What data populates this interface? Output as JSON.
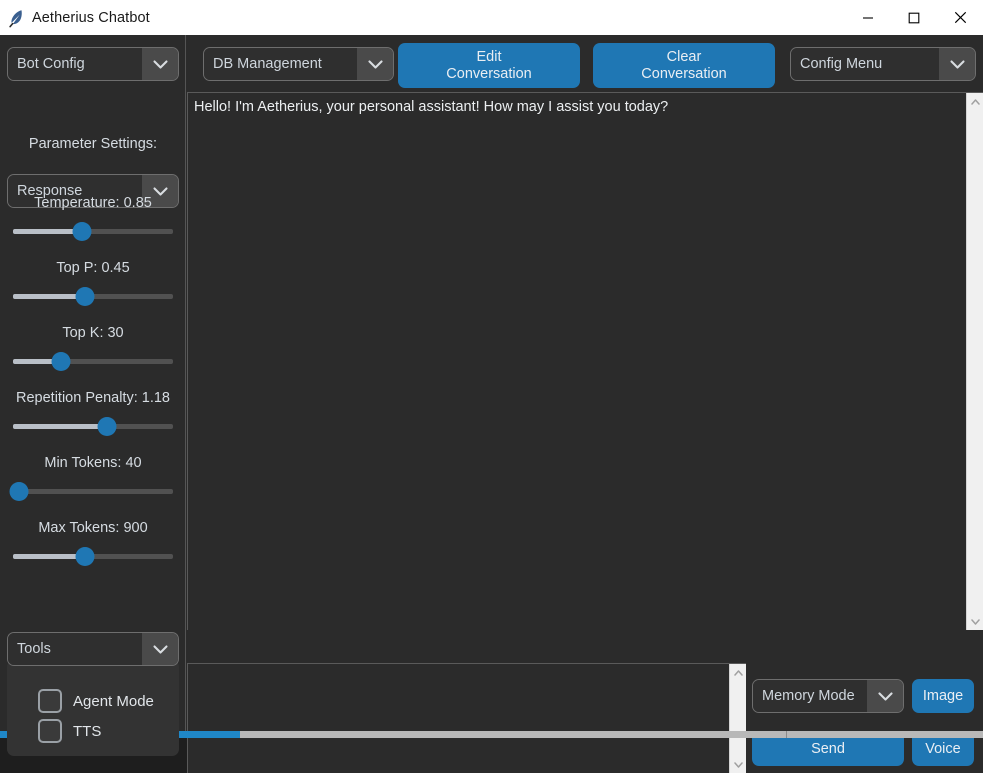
{
  "window": {
    "title": "Aetherius Chatbot",
    "icon": "feather-icon",
    "controls": {
      "minimize": "minimize-icon",
      "maximize": "maximize-icon",
      "close": "close-icon"
    },
    "titlebar_bg": "#ffffff",
    "body_bg": "#2b2b2b",
    "accent": "#1f77b4"
  },
  "sidebar": {
    "bot_config": {
      "label": "Bot Config",
      "arrow": "chevron-down-icon"
    },
    "parameter_settings_label": "Parameter Settings:",
    "response": {
      "label": "Response",
      "arrow": "chevron-down-icon"
    },
    "sliders": [
      {
        "name": "temperature",
        "label": "Temperature: 0.85",
        "value": 0.85,
        "percent": 43
      },
      {
        "name": "top-p",
        "label": "Top P: 0.45",
        "value": 0.45,
        "percent": 45
      },
      {
        "name": "top-k",
        "label": "Top K: 30",
        "value": 30,
        "percent": 30
      },
      {
        "name": "repetition-penalty",
        "label": "Repetition Penalty: 1.18",
        "value": 1.18,
        "percent": 59
      },
      {
        "name": "min-tokens",
        "label": "Min Tokens: 40",
        "value": 40,
        "percent": 4
      },
      {
        "name": "max-tokens",
        "label": "Max Tokens: 900",
        "value": 900,
        "percent": 45
      }
    ],
    "tools": {
      "label": "Tools",
      "arrow": "chevron-down-icon"
    },
    "tool_options": [
      {
        "name": "agent-mode",
        "label": "Agent Mode",
        "checked": false
      },
      {
        "name": "tts",
        "label": "TTS",
        "checked": false
      }
    ]
  },
  "toolbar": {
    "db_management": {
      "label": "DB Management",
      "arrow": "chevron-down-icon"
    },
    "edit_conversation": "Edit\nConversation",
    "clear_conversation": "Clear\nConversation",
    "config_menu": {
      "label": "Config Menu",
      "arrow": "chevron-down-icon"
    }
  },
  "chat": {
    "messages": [
      "Hello! I'm Aetherius, your personal assistant! How may I assist you today?"
    ],
    "first_message": "Hello! I'm Aetherius, your personal assistant! How may I assist you today?",
    "scrollbar": {
      "up": "chevron-up-icon",
      "down": "chevron-down-icon"
    }
  },
  "input": {
    "value": "",
    "placeholder": "",
    "scrollbar": {
      "up": "chevron-up-icon",
      "down": "chevron-down-icon"
    }
  },
  "actions": {
    "memory_mode": {
      "label": "Memory Mode",
      "arrow": "chevron-down-icon"
    },
    "image": "Image",
    "send": "Send",
    "voice": "Voice"
  }
}
